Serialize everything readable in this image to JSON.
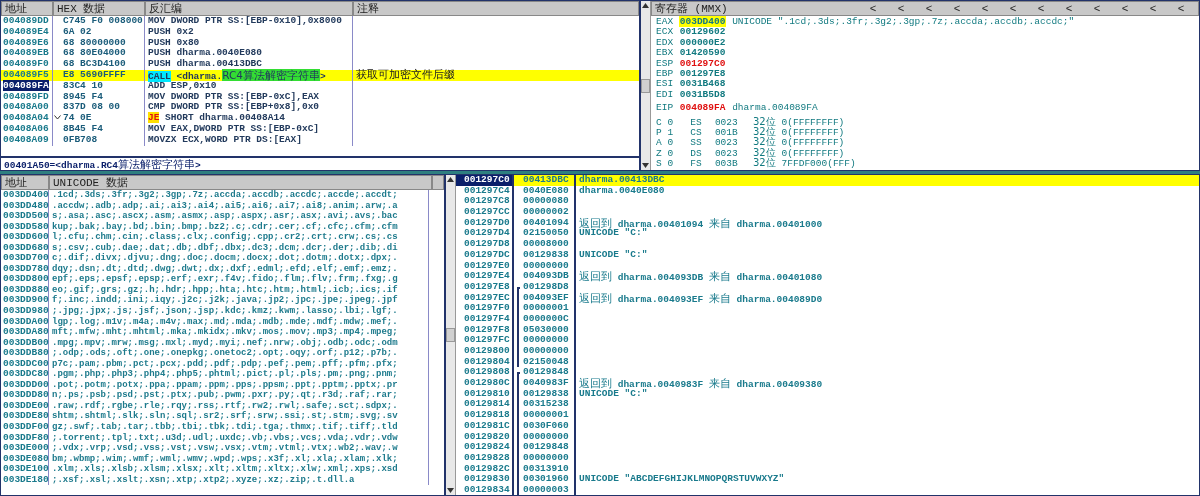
{
  "disassembly": {
    "columns": [
      "地址",
      "HEX 数据",
      "反汇编",
      "注释"
    ],
    "rows": [
      {
        "address": "004089DD",
        "hex": "C745 F0 008000",
        "code": [
          {
            "text": "MOV DWORD PTR SS:[EBP-0x10],0x8000"
          }
        ],
        "selected": false,
        "highlighted": false
      },
      {
        "address": "004089E4",
        "hex": "6A 02",
        "code": [
          {
            "text": "PUSH 0x2"
          }
        ],
        "selected": false,
        "highlighted": false
      },
      {
        "address": "004089E6",
        "hex": "68 80000000",
        "code": [
          {
            "text": "PUSH 0x80"
          }
        ],
        "selected": false,
        "highlighted": false
      },
      {
        "address": "004089EB",
        "hex": "68 80E04000",
        "code": [
          {
            "text": "PUSH dharma.0040E080"
          }
        ],
        "selected": false,
        "highlighted": false
      },
      {
        "address": "004089F0",
        "hex": "68 BC3D4100",
        "code": [
          {
            "text": "PUSH dharma.00413DBC"
          }
        ],
        "selected": false,
        "highlighted": false
      },
      {
        "address": "004089F5",
        "hex": "E8 5690FFFF",
        "code": [
          {
            "text": "CALL",
            "kind": "call"
          },
          {
            "text": " <dharma."
          },
          {
            "text": "RC4算法解密字符串",
            "kind": "label"
          },
          {
            "text": ">"
          }
        ],
        "comment": "获取可加密文件后缀",
        "selected": false,
        "highlighted": true
      },
      {
        "address": "004089FA",
        "hex": "83C4 10",
        "code": [
          {
            "text": "ADD ESP,0x10"
          }
        ],
        "selected": true,
        "highlighted": false
      },
      {
        "address": "004089FD",
        "hex": "8945 F4",
        "code": [
          {
            "text": "MOV DWORD PTR SS:[EBP-0xC],EAX"
          }
        ],
        "selected": false,
        "highlighted": false
      },
      {
        "address": "00408A00",
        "hex": "837D 08 00",
        "code": [
          {
            "text": "CMP DWORD PTR SS:[EBP+0x8],0x0"
          }
        ],
        "selected": false,
        "highlighted": false
      },
      {
        "address": "00408A04",
        "hex": "74 0E",
        "jump_arrow": true,
        "code": [
          {
            "text": "JE",
            "kind": "jump"
          },
          {
            "text": " SHORT dharma.00408A14"
          }
        ],
        "selected": false,
        "highlighted": false
      },
      {
        "address": "00408A06",
        "hex": "8B45 F4",
        "code": [
          {
            "text": "MOV EAX,DWORD PTR SS:[EBP-0xC]"
          }
        ],
        "selected": false,
        "highlighted": false
      },
      {
        "address": "00408A09",
        "hex": "0FB708",
        "code": [
          {
            "text": "MOVZX ECX,WORD PTR DS:[EAX]"
          }
        ],
        "selected": false,
        "highlighted": false
      }
    ],
    "info": "00401A50=<dharma.RC4算法解密字符串>"
  },
  "registers": {
    "title": "寄存器 (MMX)",
    "header_arrows": [
      "<",
      "<",
      "<",
      "<",
      "<",
      "<",
      "<",
      "<",
      "<",
      "<",
      "<",
      "<"
    ],
    "general": [
      {
        "name": "EAX",
        "value": "003DD400",
        "comment": "UNICODE \".1cd;.3ds;.3fr;.3g2;.3gp;.7z;.accda;.accdb;.accdc;\"",
        "highlighted": true,
        "changed": false
      },
      {
        "name": "ECX",
        "value": "00129602",
        "highlighted": false,
        "changed": false
      },
      {
        "name": "EDX",
        "value": "000000E2",
        "highlighted": false,
        "changed": false
      },
      {
        "name": "EBX",
        "value": "01420590",
        "highlighted": false,
        "changed": false
      },
      {
        "name": "ESP",
        "value": "001297C0",
        "highlighted": false,
        "changed": true
      },
      {
        "name": "EBP",
        "value": "001297E8",
        "highlighted": false,
        "changed": false
      },
      {
        "name": "ESI",
        "value": "0031B468",
        "highlighted": false,
        "changed": false
      },
      {
        "name": "EDI",
        "value": "0031B5D8",
        "highlighted": false,
        "changed": false
      }
    ],
    "eip": {
      "name": "EIP",
      "value": "004089FA",
      "comment": "dharma.004089FA",
      "changed": true
    },
    "flags": [
      {
        "flag": "C",
        "bit": "0",
        "segment": "ES",
        "selector": "0023",
        "width": "32位",
        "base": "0(FFFFFFFF)"
      },
      {
        "flag": "P",
        "bit": "1",
        "segment": "CS",
        "selector": "001B",
        "width": "32位",
        "base": "0(FFFFFFFF)"
      },
      {
        "flag": "A",
        "bit": "0",
        "segment": "SS",
        "selector": "0023",
        "width": "32位",
        "base": "0(FFFFFFFF)"
      },
      {
        "flag": "Z",
        "bit": "0",
        "segment": "DS",
        "selector": "0023",
        "width": "32位",
        "base": "0(FFFFFFFF)"
      },
      {
        "flag": "S",
        "bit": "0",
        "segment": "FS",
        "selector": "003B",
        "width": "32位",
        "base": "7FFDF000(FFF)"
      }
    ]
  },
  "dump": {
    "columns": [
      "地址",
      "UNICODE 数据"
    ],
    "rows": [
      {
        "address": "003DD400",
        "text": ".1cd;.3ds;.3fr;.3g2;.3gp;.7z;.accda;.accdb;.accdc;.accde;.accdt;"
      },
      {
        "address": "003DD480",
        "text": ".accdw;.adb;.adp;.ai;.ai3;.ai4;.ai5;.ai6;.ai7;.ai8;.anim;.arw;.a"
      },
      {
        "address": "003DD500",
        "text": "s;.asa;.asc;.ascx;.asm;.asmx;.asp;.aspx;.asr;.asx;.avi;.avs;.bac"
      },
      {
        "address": "003DD580",
        "text": "kup;.bak;.bay;.bd;.bin;.bmp;.bz2;.c;.cdr;.cer;.cf;.cfc;.cfm;.cfm"
      },
      {
        "address": "003DD600",
        "text": "l;.cfu;.chm;.cin;.class;.clx;.config;.cpp;.cr2;.crt;.crw;.cs;.cs"
      },
      {
        "address": "003DD680",
        "text": "s;.csv;.cub;.dae;.dat;.db;.dbf;.dbx;.dc3;.dcm;.dcr;.der;.dib;.di"
      },
      {
        "address": "003DD700",
        "text": "c;.dif;.divx;.djvu;.dng;.doc;.docm;.docx;.dot;.dotm;.dotx;.dpx;."
      },
      {
        "address": "003DD780",
        "text": "dqy;.dsn;.dt;.dtd;.dwg;.dwt;.dx;.dxf;.edml;.efd;.elf;.emf;.emz;."
      },
      {
        "address": "003DD800",
        "text": "epf;.eps;.epsf;.epsp;.erf;.exr;.f4v;.fido;.flm;.flv;.frm;.fxg;.g"
      },
      {
        "address": "003DD880",
        "text": "eo;.gif;.grs;.gz;.h;.hdr;.hpp;.hta;.htc;.htm;.html;.icb;.ics;.if"
      },
      {
        "address": "003DD900",
        "text": "f;.inc;.indd;.ini;.iqy;.j2c;.j2k;.java;.jp2;.jpc;.jpe;.jpeg;.jpf"
      },
      {
        "address": "003DD980",
        "text": ";.jpg;.jpx;.js;.jsf;.json;.jsp;.kdc;.kmz;.kwm;.lasso;.lbi;.lgf;."
      },
      {
        "address": "003DDA00",
        "text": "lgp;.log;.m1v;.m4a;.m4v;.max;.md;.mda;.mdb;.mde;.mdf;.mdw;.mef;."
      },
      {
        "address": "003DDA80",
        "text": "mft;.mfw;.mht;.mhtml;.mka;.mkidx;.mkv;.mos;.mov;.mp3;.mp4;.mpeg;"
      },
      {
        "address": "003DDB00",
        "text": ".mpg;.mpv;.mrw;.msg;.mxl;.myd;.myi;.nef;.nrw;.obj;.odb;.odc;.odm"
      },
      {
        "address": "003DDB80",
        "text": ";.odp;.ods;.oft;.one;.onepkg;.onetoc2;.opt;.oqy;.orf;.p12;.p7b;."
      },
      {
        "address": "003DDC00",
        "text": "p7c;.pam;.pbm;.pct;.pcx;.pdd;.pdf;.pdp;.pef;.pem;.pff;.pfm;.pfx;"
      },
      {
        "address": "003DDC80",
        "text": ".pgm;.php;.php3;.php4;.php5;.phtml;.pict;.pl;.pls;.pm;.png;.pnm;"
      },
      {
        "address": "003DDD00",
        "text": ".pot;.potm;.potx;.ppa;.ppam;.ppm;.pps;.ppsm;.ppt;.pptm;.pptx;.pr"
      },
      {
        "address": "003DDD80",
        "text": "n;.ps;.psb;.psd;.pst;.ptx;.pub;.pwm;.pxr;.py;.qt;.r3d;.raf;.rar;"
      },
      {
        "address": "003DDE00",
        "text": ".raw;.rdf;.rgbe;.rle;.rqy;.rss;.rtf;.rw2;.rwl;.safe;.sct;.sdpx;."
      },
      {
        "address": "003DDE80",
        "text": "shtm;.shtml;.slk;.sln;.sql;.sr2;.srf;.srw;.ssi;.st;.stm;.svg;.sv"
      },
      {
        "address": "003DDF00",
        "text": "gz;.swf;.tab;.tar;.tbb;.tbi;.tbk;.tdi;.tga;.thmx;.tif;.tiff;.tld"
      },
      {
        "address": "003DDF80",
        "text": ";.torrent;.tpl;.txt;.u3d;.udl;.uxdc;.vb;.vbs;.vcs;.vda;.vdr;.vdw"
      },
      {
        "address": "003DE000",
        "text": ";.vdx;.vrp;.vsd;.vss;.vst;.vsw;.vsx;.vtm;.vtml;.vtx;.wb2;.wav;.w"
      },
      {
        "address": "003DE080",
        "text": "bm;.wbmp;.wim;.wmf;.wml;.wmv;.wpd;.wps;.x3f;.xl;.xla;.xlam;.xlk;"
      },
      {
        "address": "003DE100",
        "text": ".xlm;.xls;.xlsb;.xlsm;.xlsx;.xlt;.xltm;.xltx;.xlw;.xml;.xps;.xsd"
      },
      {
        "address": "003DE180",
        "text": ";.xsf;.xsl;.xslt;.xsn;.xtp;.xtp2;.xyze;.xz;.zip;.t.dll.a"
      }
    ]
  },
  "stack": {
    "rows": [
      {
        "address": "001297C0",
        "value": "00413DBC",
        "comment": "dharma.00413DBC",
        "selected": true,
        "highlighted": true,
        "in_frame": false,
        "frame_start": false
      },
      {
        "address": "001297C4",
        "value": "0040E080",
        "comment": "dharma.0040E080",
        "selected": false,
        "highlighted": false,
        "in_frame": false,
        "frame_start": false
      },
      {
        "address": "001297C8",
        "value": "00000080",
        "selected": false,
        "highlighted": false,
        "in_frame": false,
        "frame_start": false
      },
      {
        "address": "001297CC",
        "value": "00000002",
        "selected": false,
        "highlighted": false,
        "in_frame": false,
        "frame_start": false
      },
      {
        "address": "001297D0",
        "value": "00401094",
        "comment": "返回到 dharma.00401094 来自 dharma.00401000",
        "selected": false,
        "highlighted": false,
        "in_frame": false,
        "frame_start": false
      },
      {
        "address": "001297D4",
        "value": "02150050",
        "comment": "UNICODE \"C:\"",
        "selected": false,
        "highlighted": false,
        "in_frame": false,
        "frame_start": false
      },
      {
        "address": "001297D8",
        "value": "00008000",
        "selected": false,
        "highlighted": false,
        "in_frame": false,
        "frame_start": false
      },
      {
        "address": "001297DC",
        "value": "00129838",
        "comment": "UNICODE \"C:\"",
        "selected": false,
        "highlighted": false,
        "in_frame": false,
        "frame_start": false
      },
      {
        "address": "001297E0",
        "value": "00000000",
        "selected": false,
        "highlighted": false,
        "in_frame": false,
        "frame_start": false
      },
      {
        "address": "001297E4",
        "value": "004093DB",
        "comment": "返回到 dharma.004093DB 来自 dharma.00401080",
        "selected": false,
        "highlighted": false,
        "in_frame": false,
        "frame_start": false
      },
      {
        "address": "001297E8",
        "value": "001298D8",
        "selected": false,
        "highlighted": false,
        "in_frame": true,
        "frame_start": true
      },
      {
        "address": "001297EC",
        "value": "004093EF",
        "comment": "返回到 dharma.004093EF 来自 dharma.004089D0",
        "selected": false,
        "highlighted": false,
        "in_frame": true,
        "frame_start": false
      },
      {
        "address": "001297F0",
        "value": "00000001",
        "selected": false,
        "highlighted": false,
        "in_frame": true,
        "frame_start": false
      },
      {
        "address": "001297F4",
        "value": "0000000C",
        "selected": false,
        "highlighted": false,
        "in_frame": true,
        "frame_start": false
      },
      {
        "address": "001297F8",
        "value": "05030000",
        "selected": false,
        "highlighted": false,
        "in_frame": true,
        "frame_start": false
      },
      {
        "address": "001297FC",
        "value": "00000000",
        "selected": false,
        "highlighted": false,
        "in_frame": true,
        "frame_start": false
      },
      {
        "address": "00129800",
        "value": "00000000",
        "selected": false,
        "highlighted": false,
        "in_frame": true,
        "frame_start": false
      },
      {
        "address": "00129804",
        "value": "02150048",
        "selected": false,
        "highlighted": false,
        "in_frame": true,
        "frame_start": false
      },
      {
        "address": "00129808",
        "value": "00129848",
        "selected": false,
        "highlighted": false,
        "in_frame": true,
        "frame_start": true
      },
      {
        "address": "0012980C",
        "value": "0040983F",
        "comment": "返回到 dharma.0040983F 来自 dharma.00409380",
        "selected": false,
        "highlighted": false,
        "in_frame": true,
        "frame_start": false
      },
      {
        "address": "00129810",
        "value": "00129838",
        "comment": "UNICODE \"C:\"",
        "selected": false,
        "highlighted": false,
        "in_frame": true,
        "frame_start": false
      },
      {
        "address": "00129814",
        "value": "00315238",
        "selected": false,
        "highlighted": false,
        "in_frame": true,
        "frame_start": false
      },
      {
        "address": "00129818",
        "value": "00000001",
        "selected": false,
        "highlighted": false,
        "in_frame": true,
        "frame_start": false
      },
      {
        "address": "0012981C",
        "value": "0030F060",
        "selected": false,
        "highlighted": false,
        "in_frame": true,
        "frame_start": false
      },
      {
        "address": "00129820",
        "value": "00000000",
        "selected": false,
        "highlighted": false,
        "in_frame": true,
        "frame_start": false
      },
      {
        "address": "00129824",
        "value": "00129848",
        "selected": false,
        "highlighted": false,
        "in_frame": true,
        "frame_start": false
      },
      {
        "address": "00129828",
        "value": "00000000",
        "selected": false,
        "highlighted": false,
        "in_frame": true,
        "frame_start": false
      },
      {
        "address": "0012982C",
        "value": "00313910",
        "selected": false,
        "highlighted": false,
        "in_frame": true,
        "frame_start": false
      },
      {
        "address": "00129830",
        "value": "00301960",
        "comment": "UNICODE \"ABCDEFGHIJKLMNOPQRSTUVWXYZ\"",
        "selected": false,
        "highlighted": false,
        "in_frame": true,
        "frame_start": false
      },
      {
        "address": "00129834",
        "value": "00000003",
        "selected": false,
        "highlighted": false,
        "in_frame": true,
        "frame_start": false
      }
    ]
  }
}
